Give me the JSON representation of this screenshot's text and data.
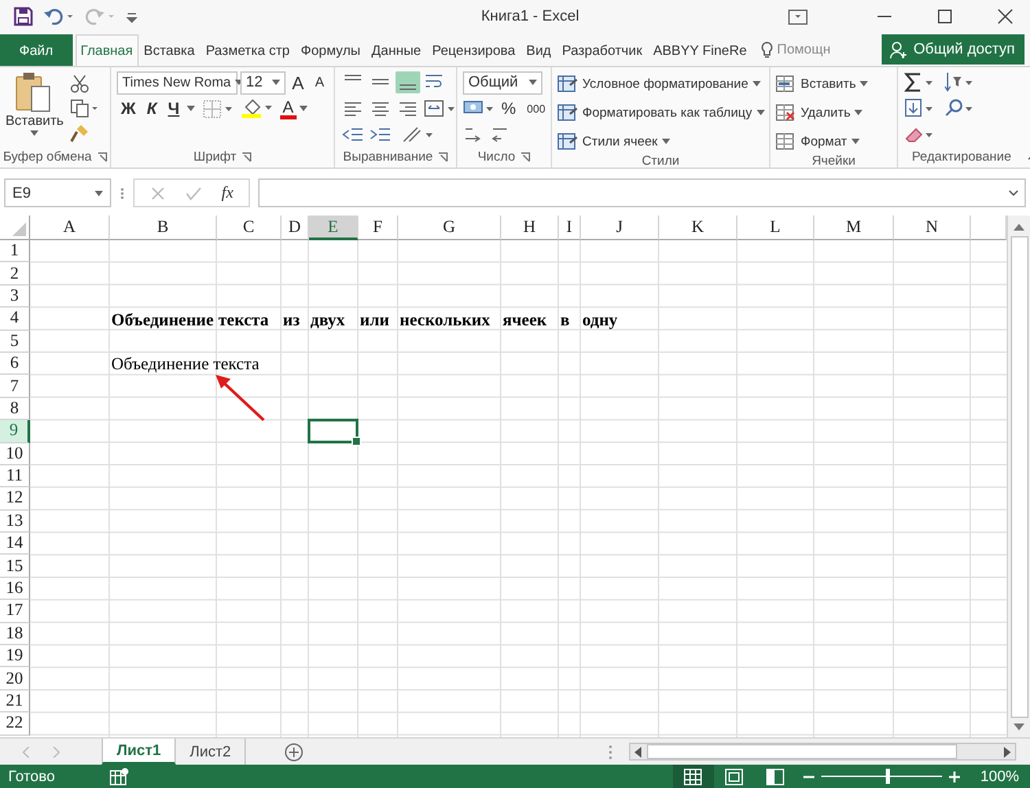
{
  "title_bar": {
    "title": "Книга1 - Excel"
  },
  "tabs": [
    {
      "label": "Файл",
      "kind": "file",
      "selected": false
    },
    {
      "label": "Главная",
      "kind": "tab",
      "selected": true
    },
    {
      "label": "Вставка",
      "kind": "tab",
      "selected": false
    },
    {
      "label": "Разметка стр",
      "kind": "tab",
      "selected": false
    },
    {
      "label": "Формулы",
      "kind": "tab",
      "selected": false
    },
    {
      "label": "Данные",
      "kind": "tab",
      "selected": false
    },
    {
      "label": "Рецензирова",
      "kind": "tab",
      "selected": false
    },
    {
      "label": "Вид",
      "kind": "tab",
      "selected": false
    },
    {
      "label": "Разработчик",
      "kind": "tab",
      "selected": false
    },
    {
      "label": "ABBYY FineRe",
      "kind": "tab",
      "selected": false
    }
  ],
  "tell_me": {
    "placeholder": "Помощн"
  },
  "share_button": {
    "label": "Общий доступ"
  },
  "ribbon": {
    "clipboard": {
      "paste": "Вставить",
      "label": "Буфер обмена"
    },
    "font": {
      "font_name": "Times New Roma",
      "font_size": "12",
      "grow": "A",
      "shrink": "A",
      "bold": "Ж",
      "italic": "К",
      "underline": "Ч",
      "font_color": "A",
      "label": "Шрифт"
    },
    "alignment": {
      "vertical_align_buttons": [
        {
          "selected": false
        },
        {
          "selected": false
        },
        {
          "selected": true
        }
      ],
      "label": "Выравнивание"
    },
    "number": {
      "format": "Общий",
      "percent": "%",
      "thousands": "000",
      "label": "Число"
    },
    "styles": {
      "items": [
        "Условное форматирование",
        "Форматировать как таблицу",
        "Стили ячеек"
      ],
      "label": "Стили"
    },
    "cells": {
      "items": [
        "Вставить",
        "Удалить",
        "Формат"
      ],
      "label": "Ячейки"
    },
    "editing": {
      "label": "Редактирование"
    }
  },
  "formula_bar": {
    "name_box": "E9",
    "function_label": "fx"
  },
  "columns": [
    {
      "label": "A",
      "selected": false
    },
    {
      "label": "B",
      "selected": false
    },
    {
      "label": "C",
      "selected": false
    },
    {
      "label": "D",
      "selected": false
    },
    {
      "label": "E",
      "selected": true
    },
    {
      "label": "F",
      "selected": false
    },
    {
      "label": "G",
      "selected": false
    },
    {
      "label": "H",
      "selected": false
    },
    {
      "label": "I",
      "selected": false
    },
    {
      "label": "J",
      "selected": false
    },
    {
      "label": "K",
      "selected": false
    },
    {
      "label": "L",
      "selected": false
    },
    {
      "label": "M",
      "selected": false
    },
    {
      "label": "N",
      "selected": false
    }
  ],
  "rows": [
    {
      "label": "1",
      "selected": false
    },
    {
      "label": "2",
      "selected": false
    },
    {
      "label": "3",
      "selected": false
    },
    {
      "label": "4",
      "selected": false,
      "bold": true,
      "cells": [
        null,
        "Объединение",
        "текста",
        "из",
        "двух",
        "или",
        "нескольких",
        "ячеек",
        "в",
        "одну"
      ]
    },
    {
      "label": "5",
      "selected": false
    },
    {
      "label": "6",
      "selected": false,
      "bold": false,
      "cells": [
        null,
        "Объединение текста"
      ]
    },
    {
      "label": "7",
      "selected": false
    },
    {
      "label": "8",
      "selected": false
    },
    {
      "label": "9",
      "selected": true
    },
    {
      "label": "10",
      "selected": false
    },
    {
      "label": "11",
      "selected": false
    },
    {
      "label": "12",
      "selected": false
    },
    {
      "label": "13",
      "selected": false
    },
    {
      "label": "14",
      "selected": false
    },
    {
      "label": "15",
      "selected": false
    },
    {
      "label": "16",
      "selected": false
    },
    {
      "label": "17",
      "selected": false
    },
    {
      "label": "18",
      "selected": false
    },
    {
      "label": "19",
      "selected": false
    },
    {
      "label": "20",
      "selected": false
    },
    {
      "label": "21",
      "selected": false
    },
    {
      "label": "22",
      "selected": false
    }
  ],
  "annotations": [
    {
      "kind": "arrow"
    }
  ],
  "sheets": [
    {
      "label": "Лист1",
      "selected": true
    },
    {
      "label": "Лист2",
      "selected": false
    }
  ],
  "status_bar": {
    "status": "Готово",
    "views": [
      {
        "kind": "normal",
        "selected": true
      },
      {
        "kind": "page_layout",
        "selected": false
      },
      {
        "kind": "page_break",
        "selected": false
      }
    ],
    "zoom": {
      "level": 0.55,
      "reading": "100%"
    }
  }
}
